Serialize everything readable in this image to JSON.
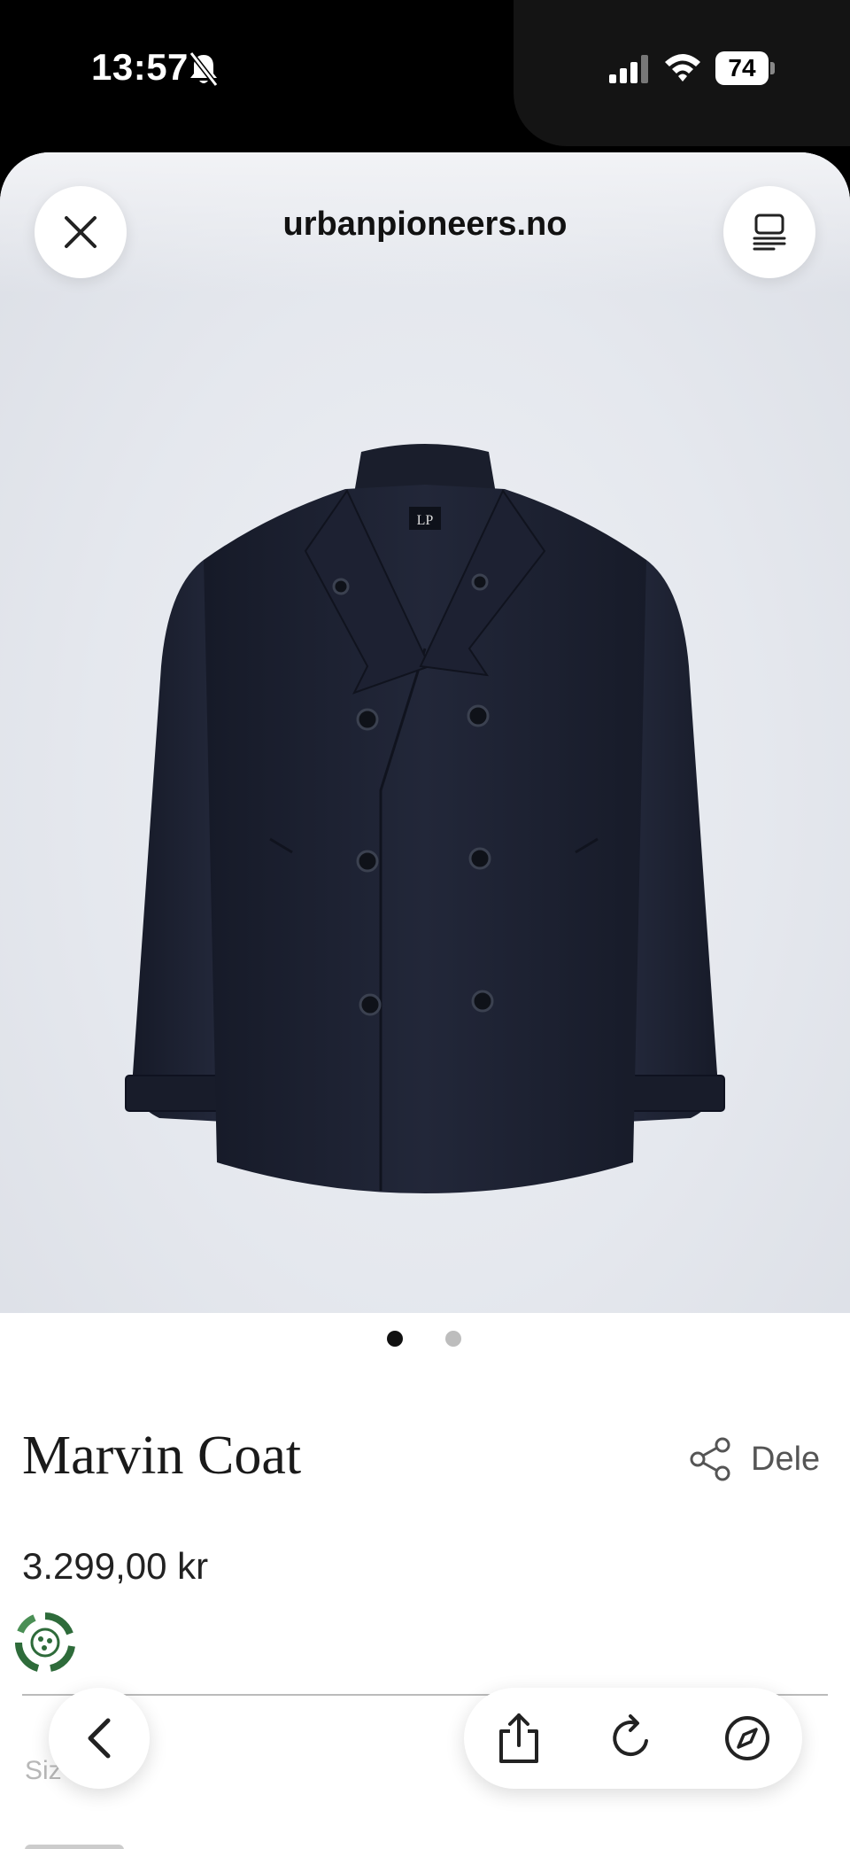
{
  "status_bar": {
    "time": "13:57",
    "battery": "74",
    "icons": [
      "bell-slash-icon",
      "signal-icon",
      "wifi-icon",
      "battery-icon"
    ]
  },
  "browser": {
    "domain": "urbanpioneers.no",
    "close_icon": "close-icon",
    "reader_icon": "reader-mode-icon"
  },
  "product": {
    "image": "navy-double-breasted-coat",
    "carousel": {
      "count": 2,
      "active": 1
    },
    "title": "Marvin Coat",
    "share_label": "Dele",
    "price": "3.299,00 kr",
    "size_label": "Siz"
  },
  "toolbar": {
    "back_icon": "chevron-left-icon",
    "share_icon": "share-icon",
    "reload_icon": "reload-icon",
    "compass_icon": "compass-icon"
  },
  "colors": {
    "coat": "#1e2233",
    "hero_bg": "#e6e8ee",
    "eco_green": "#2e6b3a"
  }
}
